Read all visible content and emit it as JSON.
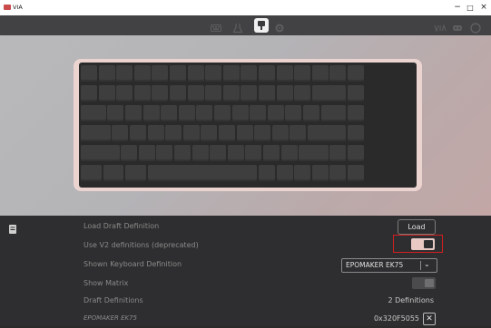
{
  "window": {
    "title": "VIA",
    "minimize": "−",
    "maximize": "□",
    "close": "×"
  },
  "menu": {
    "icons": [
      "keyboard-icon",
      "flask-icon",
      "configure-icon",
      "gear-icon"
    ],
    "active": "configure-icon",
    "right_icons": [
      "via-logo-icon",
      "discord-icon",
      "github-icon"
    ]
  },
  "colors": {
    "accent": "#e8c9c4",
    "highlight": "#d21f1f",
    "case": "#ebd4d0"
  },
  "settings": {
    "load_draft_label": "Load Draft Definition",
    "load_button": "Load",
    "use_v2_label": "Use V2 definitions (deprecated)",
    "shown_definition_label": "Shown Keyboard Definition",
    "shown_definition_value": "EPOMAKER EK75",
    "show_matrix_label": "Show Matrix",
    "draft_definitions_label": "Draft Definitions",
    "draft_definitions_count": "2 Definitions",
    "draft_item_name": "EPOMAKER EK75",
    "draft_item_id": "0x320F5055",
    "delete_glyph": "✕",
    "chevron": "⌄"
  }
}
